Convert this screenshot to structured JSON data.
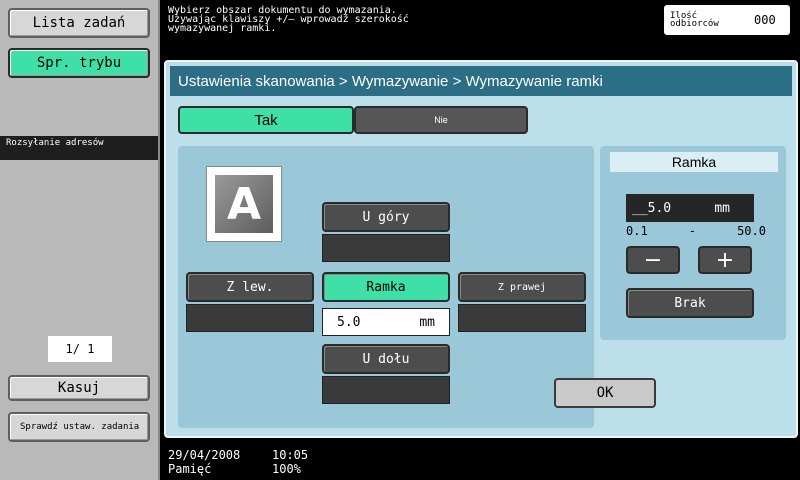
{
  "sidebar": {
    "job_list": "Lista zadań",
    "mode_check": "Spr. trybu",
    "broadcast": "Rozsyłanie adresów",
    "page_counter": "1/  1",
    "clear": "Kasuj",
    "check_job": "Sprawdź ustaw. zadania"
  },
  "header": {
    "message": "Wybierz obszar dokumentu do wymazania.\nUżywając klawiszy +/– wprowadź szerokość\nwymazywanej ramki.",
    "recipients_label": "Ilość odbiorców",
    "recipients_value": "000"
  },
  "breadcrumb": "Ustawienia skanowania > Wymazywanie > Wymazywanie ramki",
  "tabs": {
    "yes": "Tak",
    "no": "Nie"
  },
  "frame_edges": {
    "icon_letter": "A",
    "top": "U góry",
    "left": "Z lew.",
    "frame": "Ramka",
    "right": "Z prawej",
    "bottom": "U dołu",
    "frame_value": "5.0",
    "unit": "mm"
  },
  "ramka_panel": {
    "title": "Ramka",
    "value": "__5.0",
    "unit": "mm",
    "range_min": "0.1",
    "range_sep": "-",
    "range_max": "50.0",
    "minus": "−",
    "plus": "+",
    "none": "Brak"
  },
  "ok": "OK",
  "footer": {
    "date": "29/04/2008",
    "time": "10:05",
    "memory_label": "Pamięć",
    "memory_value": "100%"
  }
}
